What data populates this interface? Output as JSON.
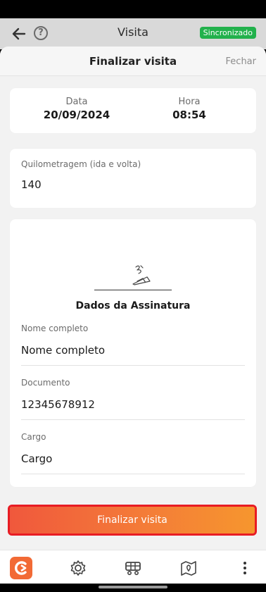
{
  "appbar": {
    "title": "Visita",
    "help_glyph": "?",
    "sync_badge": "Sincronizado",
    "sync_color": "#22b14c",
    "back_icon": "arrow-left-icon",
    "help_icon": "question-circle-icon"
  },
  "sheet": {
    "title": "Finalizar visita",
    "close_label": "Fechar"
  },
  "datetime": {
    "date_label": "Data",
    "date_value": "20/09/2024",
    "time_label": "Hora",
    "time_value": "08:54"
  },
  "mileage": {
    "label": "Quilometragem (ida e volta)",
    "value": "140"
  },
  "signature": {
    "title": "Dados da Assinatura",
    "icon": "signature-icon",
    "fields": [
      {
        "label": "Nome completo",
        "value": "Nome completo"
      },
      {
        "label": "Documento",
        "value": "12345678912"
      },
      {
        "label": "Cargo",
        "value": "Cargo"
      }
    ]
  },
  "actions": {
    "finish_label": "Finalizar visita",
    "accent_color": "#f26a35"
  },
  "bottom_nav": {
    "items": [
      "logo-icon",
      "gear-icon",
      "cart-icon",
      "map-pin-icon",
      "more-vertical-icon"
    ]
  }
}
